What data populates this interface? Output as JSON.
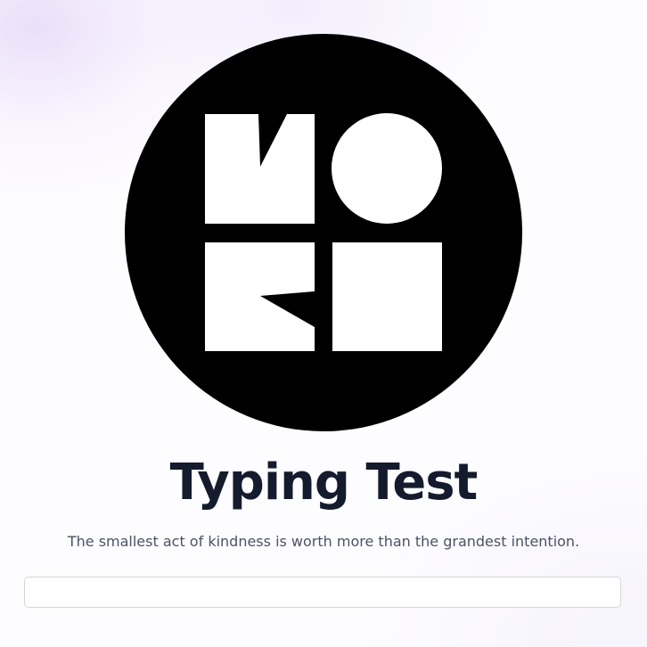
{
  "brand": {
    "logo_text": "MOKI"
  },
  "page": {
    "title": "Typing Test",
    "quote": "The smallest act of kindness is worth more than the grandest intention."
  },
  "typing_input": {
    "value": "",
    "placeholder": ""
  },
  "colors": {
    "title": "#141b2d",
    "quote": "#4b5364",
    "logo_background": "#000000",
    "logo_shapes": "#ffffff",
    "input_border": "#d4d6dc"
  },
  "icons": {
    "logo": "moki-logo-icon"
  }
}
